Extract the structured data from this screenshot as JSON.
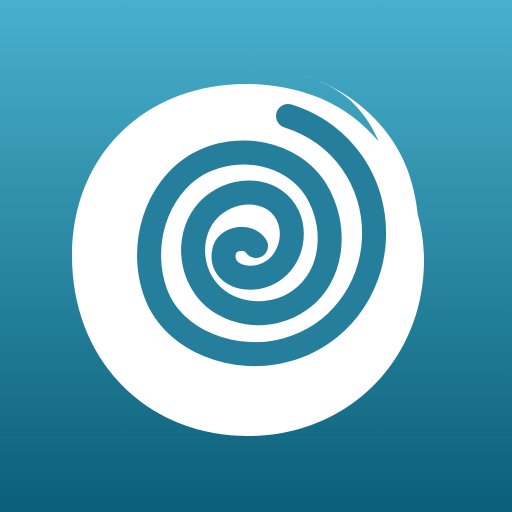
{
  "icon": {
    "name": "spiral-icon",
    "background_top": "#49b0cd",
    "background_bottom": "#0b5f78",
    "symbol_color": "#ffffff",
    "groove_color": "#257f9c"
  }
}
